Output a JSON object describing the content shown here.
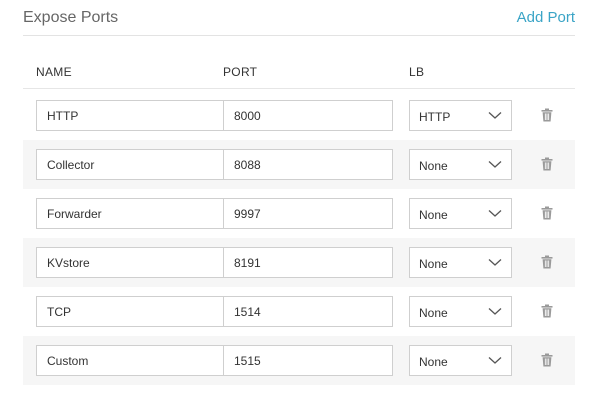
{
  "header": {
    "title": "Expose Ports",
    "add_port_label": "Add Port"
  },
  "columns": {
    "name": "NAME",
    "port": "PORT",
    "lb": "LB"
  },
  "rows": [
    {
      "name": "HTTP",
      "port": "8000",
      "lb": "HTTP"
    },
    {
      "name": "Collector",
      "port": "8088",
      "lb": "None"
    },
    {
      "name": "Forwarder",
      "port": "9997",
      "lb": "None"
    },
    {
      "name": "KVstore",
      "port": "8191",
      "lb": "None"
    },
    {
      "name": "TCP",
      "port": "1514",
      "lb": "None"
    },
    {
      "name": "Custom",
      "port": "1515",
      "lb": "None"
    }
  ],
  "icons": {
    "select_arrow": "chevron-down-icon",
    "delete": "trash-icon"
  },
  "colors": {
    "accent": "#3aa4c6",
    "row_shade": "#f6f6f6"
  }
}
